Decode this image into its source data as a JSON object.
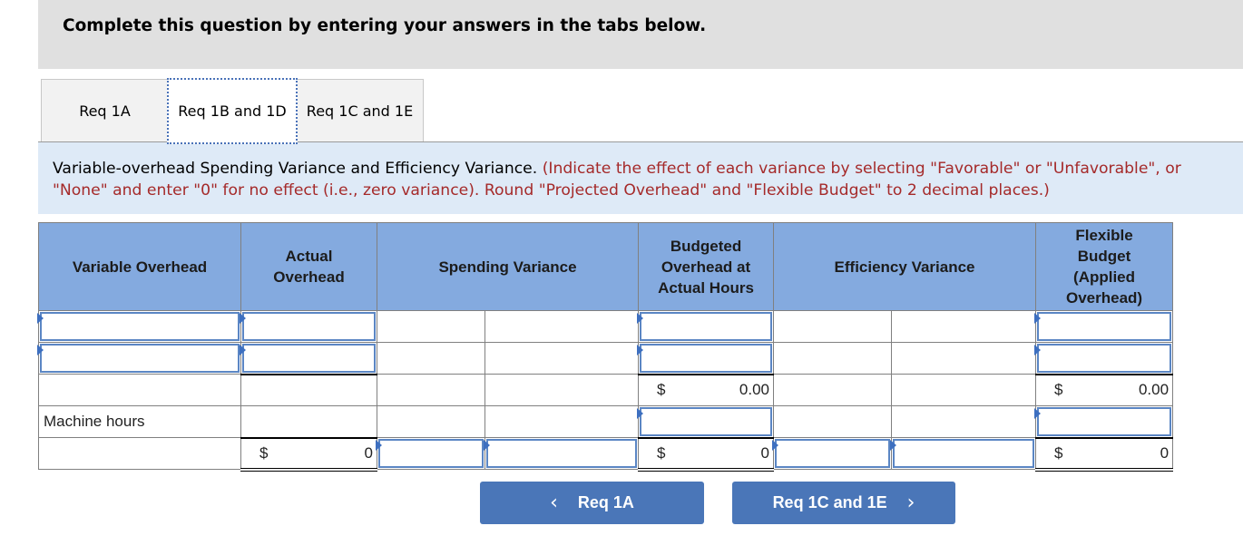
{
  "header": {
    "title": "Complete this question by entering your answers in the tabs below."
  },
  "tabs": [
    {
      "label": "Req 1A",
      "active": false
    },
    {
      "label": "Req 1B and 1D",
      "active": true
    },
    {
      "label": "Req 1C and 1E",
      "active": false
    }
  ],
  "instructions": {
    "title": "Variable-overhead Spending Variance and Efficiency Variance.",
    "note_line1": "(Indicate the effect of each variance by selecting \"Favorable\" or \"Unfavorable\", or",
    "note_line2": "\"None\" and enter \"0\" for no effect (i.e., zero variance). Round \"Projected Overhead\" and \"Flexible Budget\" to 2 decimal places.)"
  },
  "table": {
    "headers": {
      "variable_overhead": "Variable Overhead",
      "actual_overhead": "Actual Overhead",
      "spending_variance": "Spending Variance",
      "budgeted_overhead": "Budgeted Overhead at Actual Hours",
      "efficiency_variance": "Efficiency Variance",
      "flexible_budget": "Flexible Budget (Applied Overhead)"
    },
    "rows": {
      "row3": {
        "budgeted_currency": "$",
        "budgeted_value": "0.00",
        "flexible_currency": "$",
        "flexible_value": "0.00"
      },
      "row4": {
        "label": "Machine hours"
      },
      "row5": {
        "actual_currency": "$",
        "actual_value": "0",
        "budgeted_currency": "$",
        "budgeted_value": "0",
        "flexible_currency": "$",
        "flexible_value": "0"
      }
    }
  },
  "navigation": {
    "prev_label": "Req 1A",
    "next_label": "Req 1C and 1E",
    "prev_icon": "‹",
    "next_icon": "›"
  }
}
